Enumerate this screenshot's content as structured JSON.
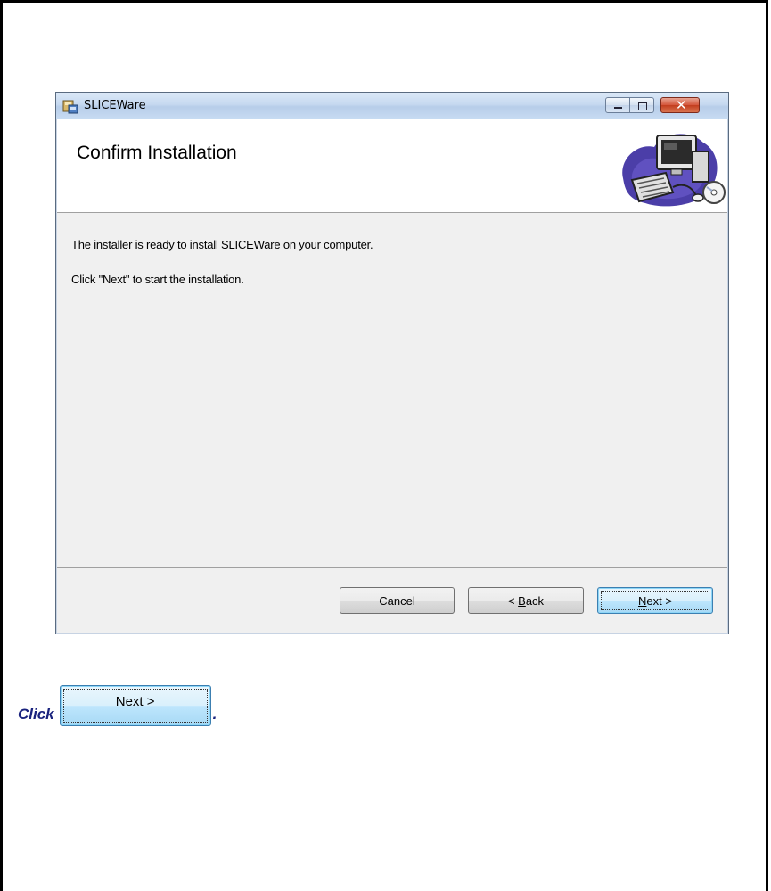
{
  "window": {
    "title": "SLICEWare"
  },
  "banner": {
    "title": "Confirm Installation",
    "art_icon": "computer-setup-icon"
  },
  "content": {
    "line1": "The installer is ready to install SLICEWare on your computer.",
    "line2": "Click \"Next\" to start the installation."
  },
  "buttons": {
    "cancel": "Cancel",
    "back_prefix": "< ",
    "back_accel": "B",
    "back_rest": "ack",
    "next_accel": "N",
    "next_rest": "ext >"
  },
  "instruction": {
    "prefix": "Click",
    "button_accel": "N",
    "button_rest": "ext >",
    "suffix": "."
  },
  "colors": {
    "accent_text": "#1a237e",
    "default_button": "#3c7fb1",
    "close_button": "#c23d1e"
  }
}
